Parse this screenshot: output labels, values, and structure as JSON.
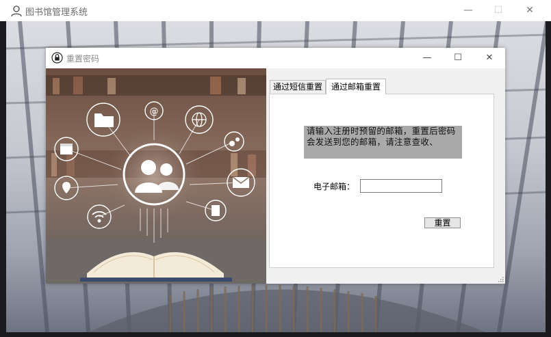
{
  "outer_window": {
    "title": "图书馆管理系统",
    "controls": {
      "minimize": "—",
      "maximize": "☐",
      "close": "✕"
    }
  },
  "dialog": {
    "title": "重置密码",
    "controls": {
      "minimize": "—",
      "maximize": "☐",
      "close": "✕"
    },
    "tabs": [
      {
        "label": "通过短信重置",
        "active": false
      },
      {
        "label": "通过邮箱重置",
        "active": true
      }
    ],
    "notice": "请输入注册时预留的邮箱，重置后密码会发送到您的邮箱，请注意查收、",
    "email_label": "电子邮箱：",
    "email_value": "",
    "reset_label": "重置"
  },
  "icons": [
    "user-icon",
    "lock-icon",
    "folder-icon",
    "at-icon",
    "globe-icon",
    "gear-icon",
    "calendar-icon",
    "mail-icon",
    "location-icon",
    "wifi-icon",
    "document-icon",
    "people-icon",
    "book-icon"
  ],
  "colors": {
    "notice_bg": "#a9a9a9",
    "dialog_bg": "#f0f0f0",
    "titlebar_bg": "#ffffff"
  }
}
